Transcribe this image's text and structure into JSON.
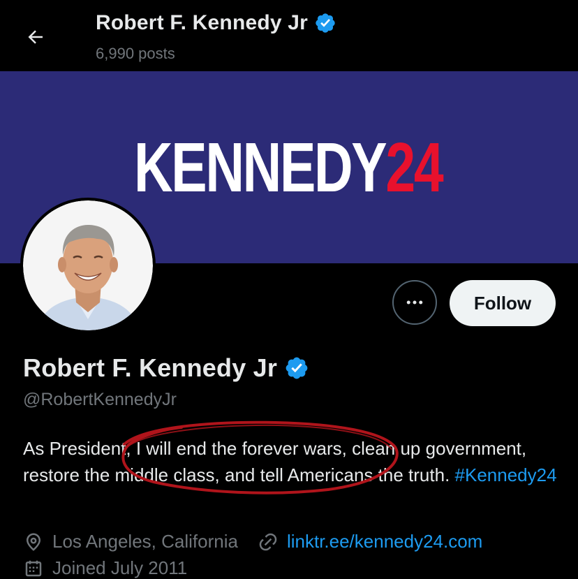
{
  "header": {
    "title": "Robert F. Kennedy Jr",
    "posts_count": "6,990 posts",
    "back_icon": "arrow-left-icon",
    "verified_icon": "verified-badge-icon"
  },
  "banner": {
    "text_main": "KENNEDY",
    "text_accent": "24",
    "background_color": "#2c2b77",
    "accent_color": "#e8112d"
  },
  "profile": {
    "avatar_icon": "profile-photo",
    "more_icon": "more-horizontal-icon",
    "follow_label": "Follow",
    "display_name": "Robert F. Kennedy Jr",
    "handle": "@RobertKennedyJr",
    "bio_text": "As President, I will end the forever wars, clean up government, restore the middle class, and tell Americans the truth.",
    "bio_hashtag": "#Kennedy24",
    "location": "Los Angeles, California",
    "location_icon": "location-pin-icon",
    "website": "linktr.ee/kennedy24.com",
    "link_icon": "link-icon",
    "joined": "Joined July 2011",
    "calendar_icon": "calendar-icon"
  },
  "colors": {
    "verified_blue": "#1d9bf0",
    "link_blue": "#1d9bf0",
    "annotation_red": "#b0141b"
  }
}
